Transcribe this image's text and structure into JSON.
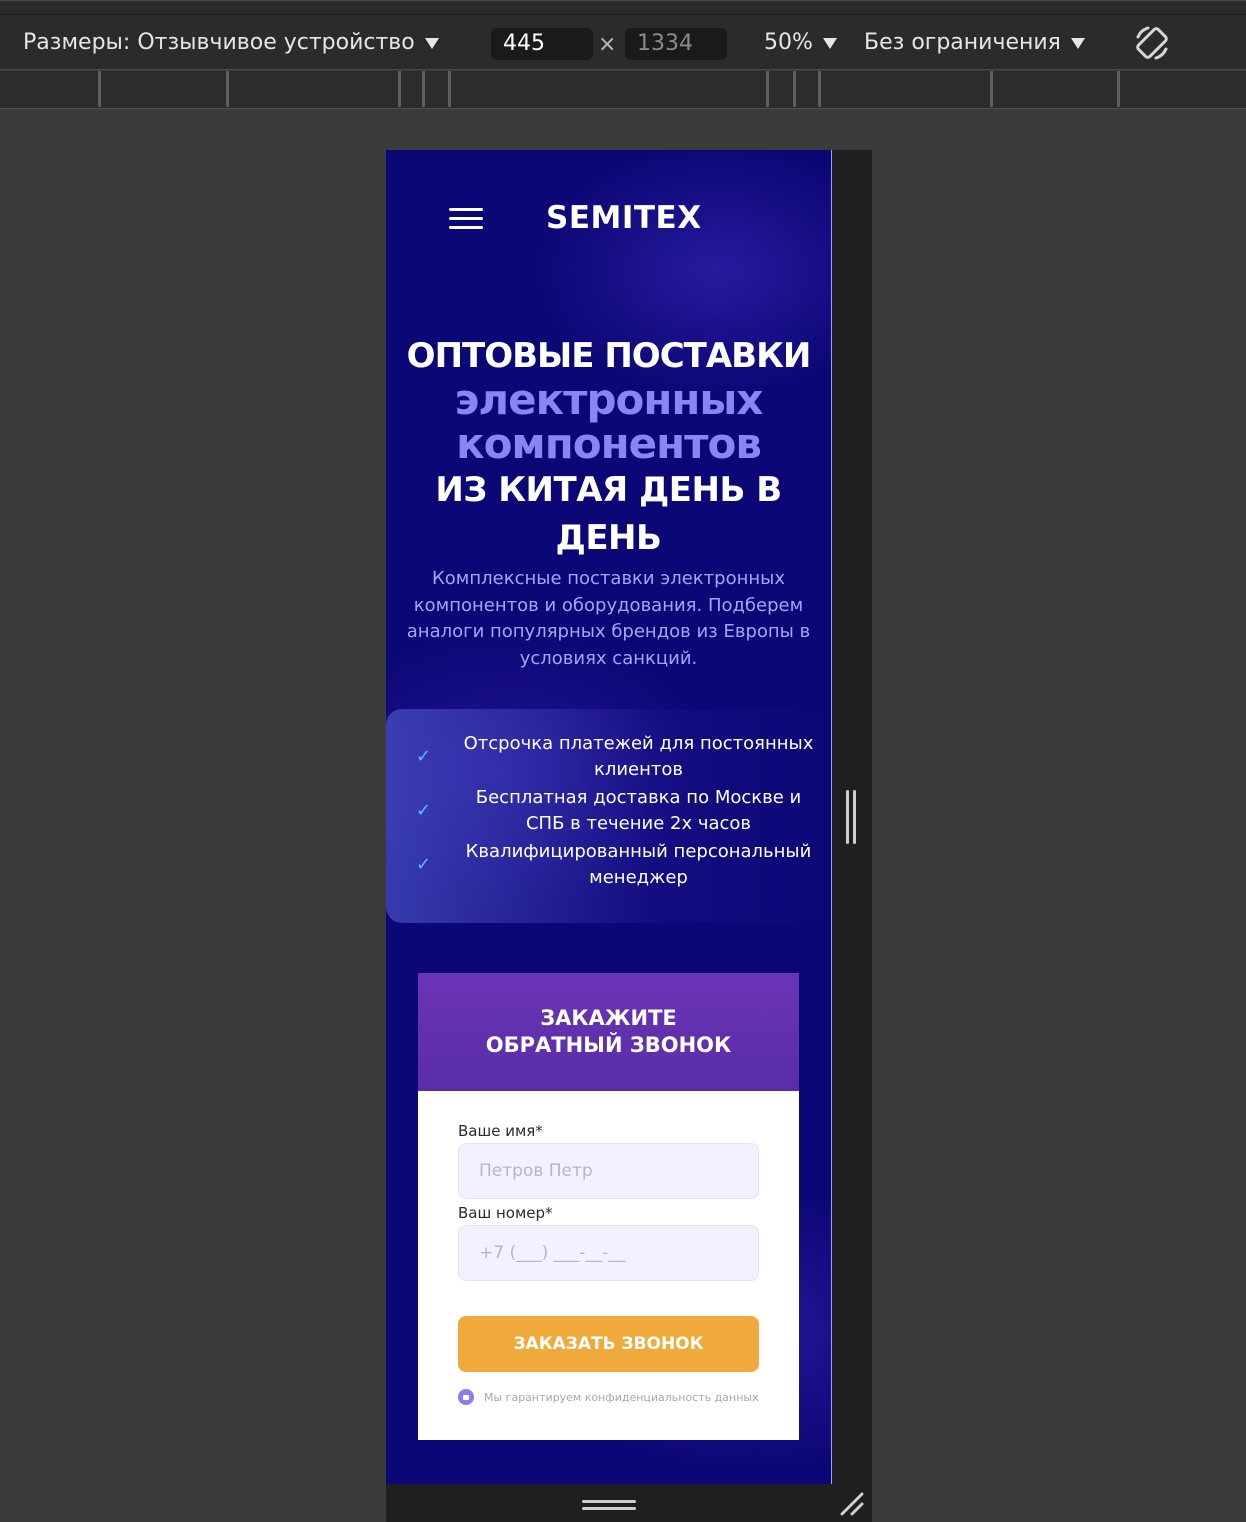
{
  "devtools": {
    "dimensions_label": "Размеры: Отзывчивое устройство",
    "width_value": "445",
    "height_value": "1334",
    "times": "×",
    "zoom": "50%",
    "throttle": "Без ограничения",
    "rotate_icon": "rotate-icon"
  },
  "site": {
    "logo": "SEMITEX",
    "menu_icon": "hamburger-icon",
    "hero": {
      "line1": "ОПТОВЫЕ ПОСТАВКИ",
      "line2a": "электронных",
      "line2b": "компонентов",
      "line3a": "ИЗ КИТАЯ ДЕНЬ В",
      "line3b": "ДЕНЬ",
      "subtitle": "Комплексные поставки электронных компонентов и оборудования. Подберем аналоги популярных брендов из Европы в условиях санкций."
    },
    "features": [
      {
        "icon": "check-icon",
        "text": "Отсрочка платежей для постоянных клиентов"
      },
      {
        "icon": "check-icon",
        "text": "Бесплатная доставка по Москве и СПБ в течение 2х часов"
      },
      {
        "icon": "check-icon",
        "text": "Квалифицированный персональный менеджер"
      }
    ],
    "form": {
      "title_line1": "ЗАКАЖИТЕ",
      "title_line2": "ОБРАТНЫЙ ЗВОНОК",
      "name_label": "Ваше имя*",
      "name_placeholder": "Петров Петр",
      "phone_label": "Ваш номер*",
      "phone_placeholder": "+7 (___) ___-__-__",
      "submit_label": "ЗАКАЗАТЬ ЗВОНОК",
      "privacy_icon": "lock-icon",
      "privacy_note": "Мы гарантируем конфиденциальность данных"
    },
    "colors": {
      "background": "#0c0776",
      "accent_text": "#8b85f4",
      "form_header": "#6a34b6",
      "button": "#f0aa3c"
    }
  }
}
